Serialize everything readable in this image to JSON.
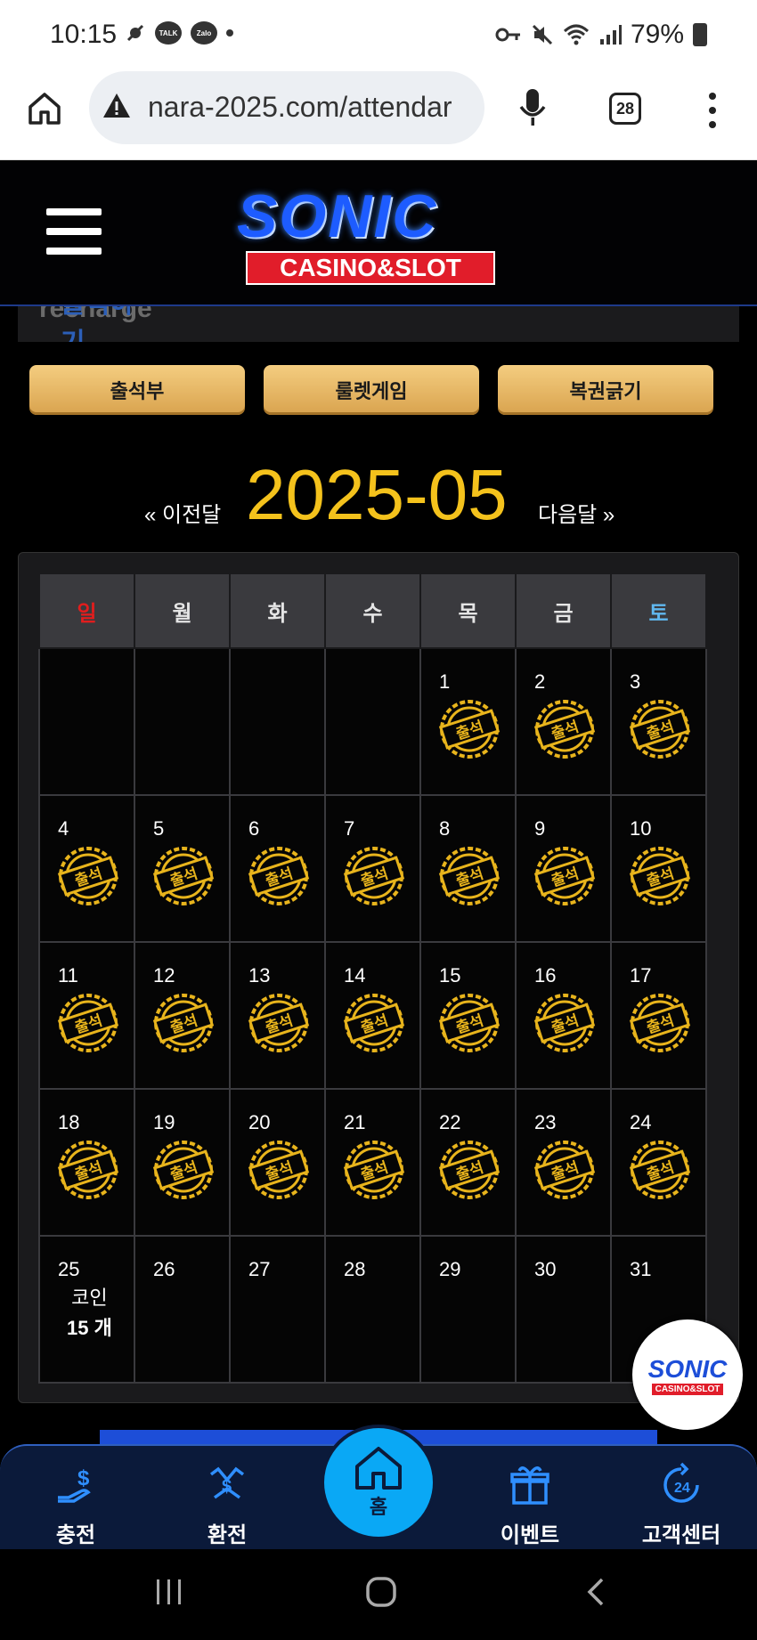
{
  "status": {
    "time": "10:15",
    "chip1": "TALK",
    "chip2": "Zalo",
    "battery": "79%"
  },
  "browser": {
    "url": "nara-2025.com/attendar",
    "tab_count": "28"
  },
  "site": {
    "logo_main": "SONIC",
    "logo_sub": "CASINO&SLOT",
    "subtitle_strip": "출석하기",
    "subtitle_strip_rest": "recharge"
  },
  "tabs": [
    "출석부",
    "룰렛게임",
    "복권긁기"
  ],
  "month_nav": {
    "prev": "« 이전달",
    "title": "2025-05",
    "next": "다음달 »"
  },
  "calendar": {
    "weekdays": [
      "일",
      "월",
      "화",
      "수",
      "목",
      "금",
      "토"
    ],
    "stamp_text": "출석",
    "coin_label": "코인",
    "coin_amount": "15 개"
  },
  "bottom_nav": {
    "charge": "충전",
    "exchange": "환전",
    "home": "홈",
    "event": "이벤트",
    "support": "고객센터"
  }
}
